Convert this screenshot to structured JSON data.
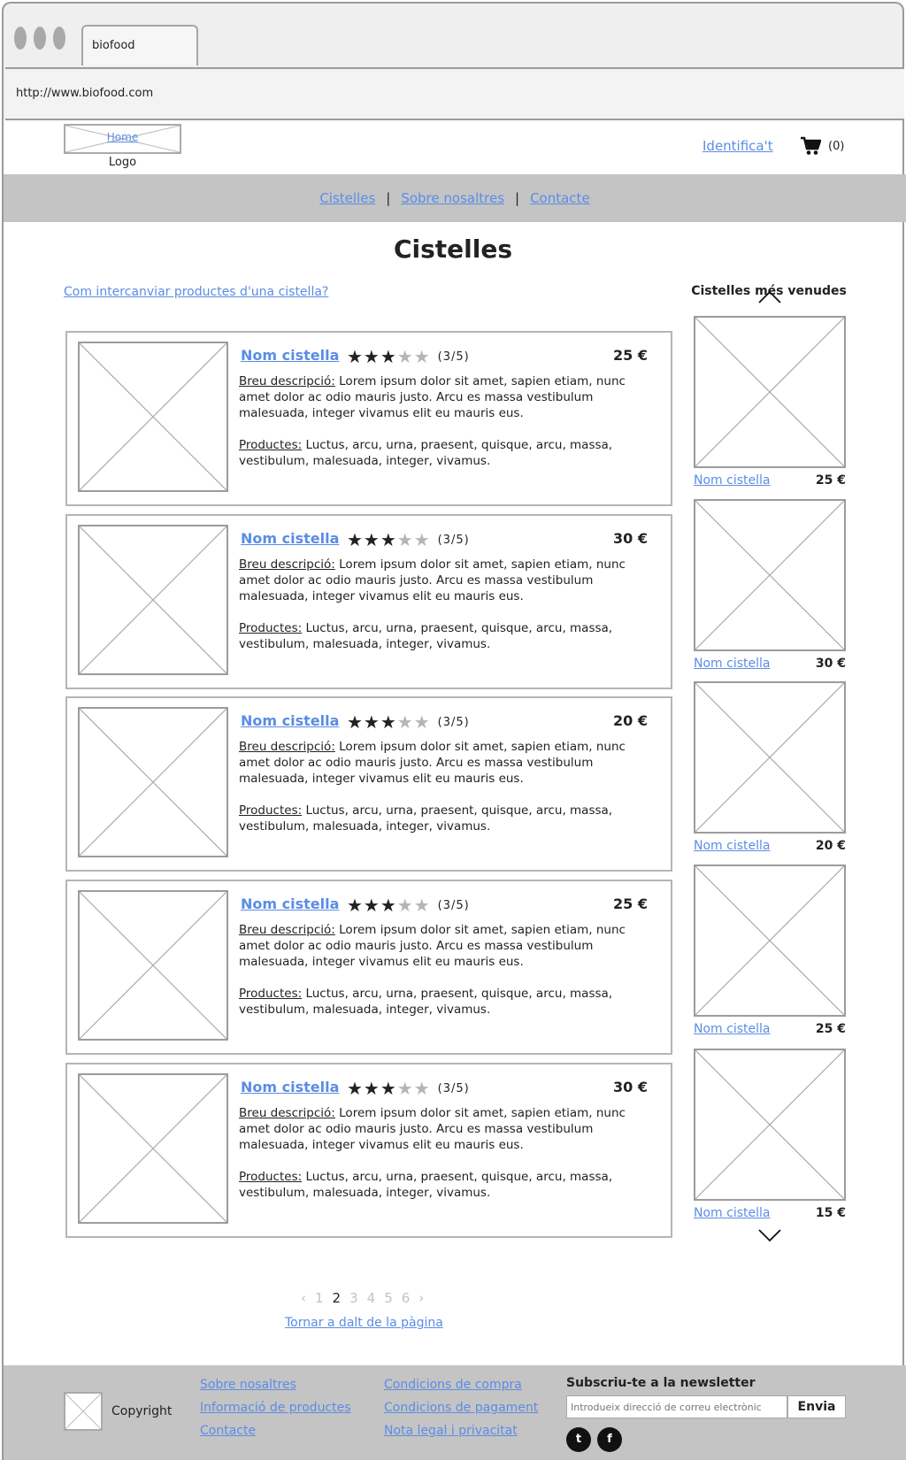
{
  "browser": {
    "tab_title": "biofood",
    "url": "http://www.biofood.com"
  },
  "header": {
    "logo_link": "Home",
    "logo_label": "Logo",
    "login": "Identifica't",
    "cart_count": "(0)"
  },
  "nav": {
    "items": [
      "Cistelles",
      "Sobre nosaltres",
      "Contacte"
    ],
    "separator": "|"
  },
  "main": {
    "title": "Cistelles",
    "help_link": "Com intercanviar productes d'una cistella?"
  },
  "products": [
    {
      "name": "Nom cistella",
      "stars_on": "★★★",
      "stars_off": "★★",
      "rating": "(3/5)",
      "price": "25 €",
      "desc_label": "Breu descripció:",
      "desc": " Lorem ipsum dolor sit amet, sapien etiam, nunc amet dolor ac odio mauris justo. Arcu es massa vestibulum malesuada, integer vivamus elit eu mauris eus.",
      "prods_label": "Productes:",
      "prods": " Luctus, arcu, urna, praesent, quisque, arcu, massa, vestibulum, malesuada, integer, vivamus."
    },
    {
      "name": "Nom cistella",
      "stars_on": "★★★",
      "stars_off": "★★",
      "rating": "(3/5)",
      "price": "30 €",
      "desc_label": "Breu descripció:",
      "desc": " Lorem ipsum dolor sit amet, sapien etiam, nunc amet dolor ac odio mauris justo. Arcu es massa vestibulum malesuada, integer vivamus elit eu mauris eus.",
      "prods_label": "Productes:",
      "prods": " Luctus, arcu, urna, praesent, quisque, arcu, massa, vestibulum, malesuada, integer, vivamus."
    },
    {
      "name": "Nom cistella",
      "stars_on": "★★★",
      "stars_off": "★★",
      "rating": "(3/5)",
      "price": "20 €",
      "desc_label": "Breu descripció:",
      "desc": " Lorem ipsum dolor sit amet, sapien etiam, nunc amet dolor ac odio mauris justo. Arcu es massa vestibulum malesuada, integer vivamus elit eu mauris eus.",
      "prods_label": "Productes:",
      "prods": " Luctus, arcu, urna, praesent, quisque, arcu, massa, vestibulum, malesuada, integer, vivamus."
    },
    {
      "name": "Nom cistella",
      "stars_on": "★★★",
      "stars_off": "★★",
      "rating": "(3/5)",
      "price": "25 €",
      "desc_label": "Breu descripció:",
      "desc": " Lorem ipsum dolor sit amet, sapien etiam, nunc amet dolor ac odio mauris justo. Arcu es massa vestibulum malesuada, integer vivamus elit eu mauris eus.",
      "prods_label": "Productes:",
      "prods": " Luctus, arcu, urna, praesent, quisque, arcu, massa, vestibulum, malesuada, integer, vivamus."
    },
    {
      "name": "Nom cistella",
      "stars_on": "★★★",
      "stars_off": "★★",
      "rating": "(3/5)",
      "price": "30 €",
      "desc_label": "Breu descripció:",
      "desc": " Lorem ipsum dolor sit amet, sapien etiam, nunc amet dolor ac odio mauris justo. Arcu es massa vestibulum malesuada, integer vivamus elit eu mauris eus.",
      "prods_label": "Productes:",
      "prods": " Luctus, arcu, urna, praesent, quisque, arcu, massa, vestibulum, malesuada, integer, vivamus."
    }
  ],
  "best_sellers": {
    "title": "Cistelles més venudes",
    "items": [
      {
        "name": "Nom cistella",
        "price": "25 €"
      },
      {
        "name": "Nom cistella",
        "price": "30 €"
      },
      {
        "name": "Nom cistella",
        "price": "20 €"
      },
      {
        "name": "Nom cistella",
        "price": "25 €"
      },
      {
        "name": "Nom cistella",
        "price": "15 €"
      }
    ]
  },
  "pagination": {
    "prev": "‹",
    "next": "›",
    "pages": [
      "1",
      "2",
      "3",
      "4",
      "5",
      "6"
    ],
    "current": "2",
    "back_to_top": "Tornar a dalt de la pàgina"
  },
  "footer": {
    "copyright": "Copyright",
    "col1": [
      "Sobre nosaltres",
      "Informació de productes",
      "Contacte"
    ],
    "col2": [
      "Condicions de compra",
      "Condicions de pagament",
      "Nota legal i privacitat"
    ],
    "newsletter_title": "Subscriu-te a la newsletter",
    "newsletter_placeholder": "Introdueix direcció de correu electrònic",
    "newsletter_button": "Envia",
    "social_icons": [
      "twitter-icon",
      "facebook-icon"
    ],
    "twitter_glyph": "t",
    "facebook_glyph": "f"
  }
}
